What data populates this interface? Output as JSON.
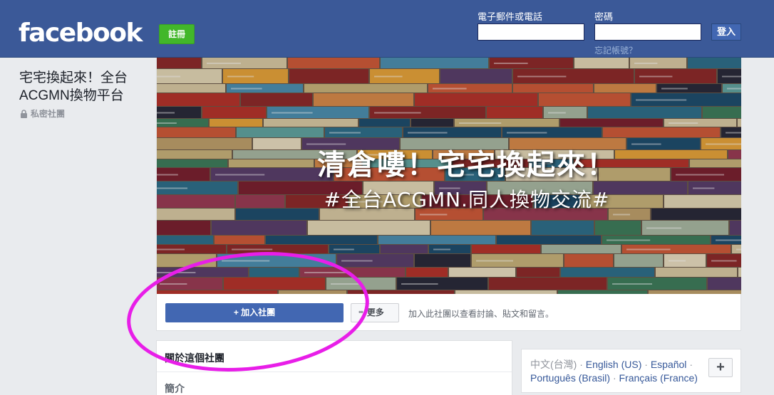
{
  "header": {
    "logo": "facebook",
    "signup_label": "註冊",
    "email_label": "電子郵件或電話",
    "password_label": "密碼",
    "login_label": "登入",
    "forgot_label": "忘記帳號？"
  },
  "group": {
    "name_line1": "宅宅換起來！全台",
    "name_line2": "ACGMN換物平台",
    "privacy": "私密社團"
  },
  "cover": {
    "title": "清倉嘍！宅宅換起來！",
    "subtitle": "#全台ACGMN.同人換物交流#",
    "book_spines": [
      "KONSALIK",
      "JULIAN GLOAG DIE SANFTE NACHT",
      "Stepperwind",
      "SO GRÜN HAUSSEN LANDS",
      "HARLEK",
      "Janet Evanovich",
      "Mitten ins Here",
      "BERTHOLD",
      "Zum Nachtisch wilde Früchte",
      "Steppenplat"
    ]
  },
  "actions": {
    "join_label": "+ 加入社團",
    "more_label": "更多",
    "join_note": "加入此社團以查看討論、貼文和留言。"
  },
  "about": {
    "title": "關於這個社團",
    "intro": "簡介"
  },
  "languages": {
    "current": "中文(台灣)",
    "items": [
      "English (US)",
      "Español",
      "Português (Brasil)",
      "Français (France)"
    ],
    "add_label": "+"
  },
  "colors": {
    "brand_blue": "#3b5998",
    "button_blue": "#4267b2",
    "signup_green": "#42b72a",
    "annotation_magenta": "#e81ee8"
  }
}
